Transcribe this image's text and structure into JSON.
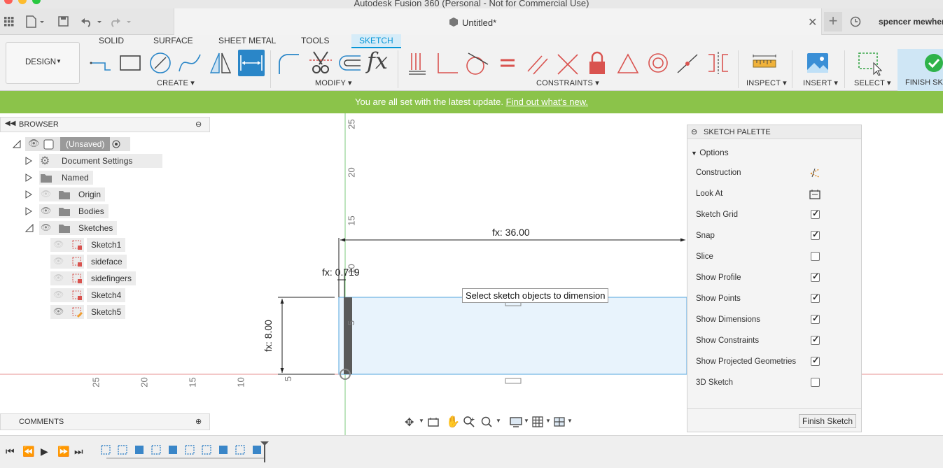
{
  "window": {
    "title": "Autodesk Fusion 360 (Personal - Not for Commercial Use)"
  },
  "tabs": {
    "document_title": "Untitled*",
    "user_name": "spencer mewhert"
  },
  "ribbon": {
    "workspace": "DESIGN",
    "tabs": [
      "SOLID",
      "SURFACE",
      "SHEET METAL",
      "TOOLS",
      "SKETCH"
    ],
    "groups": {
      "create": "CREATE",
      "modify": "MODIFY",
      "constraints": "CONSTRAINTS",
      "inspect": "INSPECT",
      "insert": "INSERT",
      "select": "SELECT",
      "finish": "FINISH SKE"
    },
    "accent": "#0696d7"
  },
  "banner": {
    "text": "You are all set with the latest update.",
    "link": "Find out what's new.",
    "color": "#8bc34a"
  },
  "browser": {
    "title": "BROWSER",
    "root": "(Unsaved)",
    "items": [
      {
        "label": "Document Settings",
        "icon": "gear-icon"
      },
      {
        "label": "Named Views",
        "icon": "folder-icon"
      },
      {
        "label": "Origin",
        "icon": "folder-icon"
      },
      {
        "label": "Bodies",
        "icon": "folder-icon"
      },
      {
        "label": "Sketches",
        "icon": "folder-icon"
      }
    ],
    "sketches": [
      "Sketch1",
      "sideface",
      "sidefingers",
      "Sketch4",
      "Sketch5"
    ]
  },
  "comments": {
    "title": "COMMENTS"
  },
  "canvas": {
    "tooltip": "Select sketch objects to dimension",
    "dim_width": "fx: 36.00",
    "dim_small": "fx: 0.719",
    "dim_height": "fx: 8.00",
    "ruler_vertical": [
      "25",
      "20",
      "15",
      "10",
      "5"
    ],
    "ruler_horizontal": [
      "25",
      "20",
      "15",
      "10",
      "5"
    ]
  },
  "palette": {
    "title": "SKETCH PALETTE",
    "section": "Options",
    "options": [
      {
        "label": "Construction",
        "type": "icon",
        "icon": "construction-icon"
      },
      {
        "label": "Look At",
        "type": "icon",
        "icon": "look-at-icon"
      },
      {
        "label": "Sketch Grid",
        "type": "check",
        "checked": true
      },
      {
        "label": "Snap",
        "type": "check",
        "checked": true
      },
      {
        "label": "Slice",
        "type": "check",
        "checked": false
      },
      {
        "label": "Show Profile",
        "type": "check",
        "checked": true
      },
      {
        "label": "Show Points",
        "type": "check",
        "checked": true
      },
      {
        "label": "Show Dimensions",
        "type": "check",
        "checked": true
      },
      {
        "label": "Show Constraints",
        "type": "check",
        "checked": true
      },
      {
        "label": "Show Projected Geometries",
        "type": "check",
        "checked": true
      },
      {
        "label": "3D Sketch",
        "type": "check",
        "checked": false
      }
    ],
    "finish_button": "Finish Sketch"
  }
}
